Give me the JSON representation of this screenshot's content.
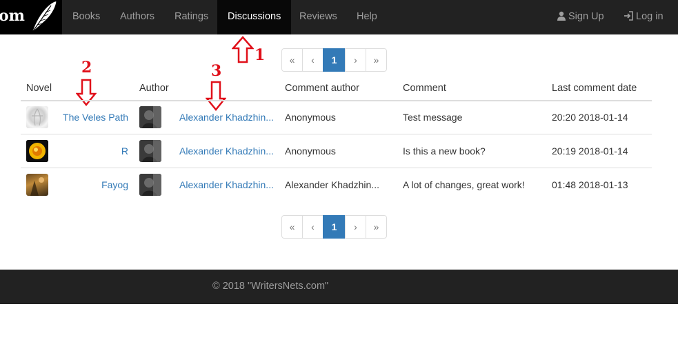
{
  "brand": {
    "text": "om"
  },
  "nav": {
    "items": [
      {
        "label": "Books"
      },
      {
        "label": "Authors"
      },
      {
        "label": "Ratings"
      },
      {
        "label": "Discussions"
      },
      {
        "label": "Reviews"
      },
      {
        "label": "Help"
      }
    ],
    "active": "Discussions",
    "sign_up": "Sign Up",
    "log_in": "Log in"
  },
  "pagination": {
    "first": "«",
    "prev": "‹",
    "current": "1",
    "next": "›",
    "last": "»"
  },
  "table": {
    "headers": [
      "Novel",
      "Author",
      "Comment author",
      "Comment",
      "Last comment date"
    ],
    "rows": [
      {
        "novel": "The Veles Path",
        "author": "Alexander Khadzhin...",
        "comment_author": "Anonymous",
        "comment": "Test message",
        "date": "20:20 2018-01-14"
      },
      {
        "novel": "R",
        "author": "Alexander Khadzhin...",
        "comment_author": "Anonymous",
        "comment": "Is this a new book?",
        "date": "20:19 2018-01-14"
      },
      {
        "novel": "Fayog",
        "author": "Alexander Khadzhin...",
        "comment_author": "Alexander Khadzhin...",
        "comment": "A lot of changes, great work!",
        "date": "01:48 2018-01-13"
      }
    ]
  },
  "annotations": [
    "1",
    "2",
    "3"
  ],
  "footer": {
    "text": "© 2018 \"WritersNets.com\""
  },
  "colors": {
    "navbar": "#222222",
    "active_nav": "#080808",
    "link": "#337ab7",
    "annotation": "#e0101a"
  },
  "icons": [
    "feather-logo-icon",
    "user-icon",
    "login-icon",
    "arrow-up-icon",
    "arrow-down-icon"
  ]
}
